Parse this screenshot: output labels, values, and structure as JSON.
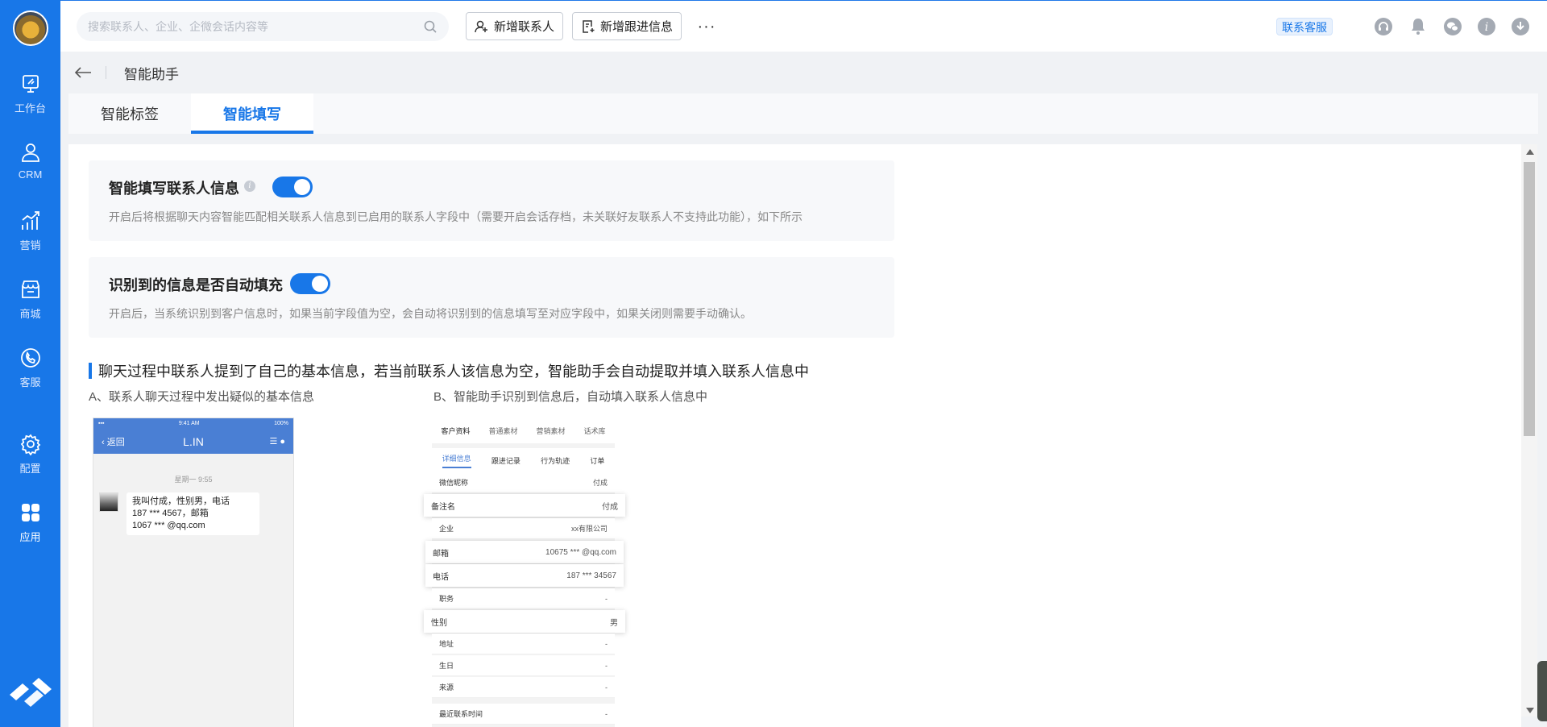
{
  "sidebar": {
    "items": [
      {
        "label": "工作台"
      },
      {
        "label": "CRM"
      },
      {
        "label": "营销"
      },
      {
        "label": "商城"
      },
      {
        "label": "客服"
      },
      {
        "label": "配置"
      },
      {
        "label": "应用"
      }
    ]
  },
  "header": {
    "search_placeholder": "搜索联系人、企业、企微会话内容等",
    "add_contact": "新增联系人",
    "add_followup": "新增跟进信息",
    "more": "···",
    "customer_service": "联系客服"
  },
  "breadcrumb": {
    "title": "智能助手"
  },
  "tabs": [
    {
      "label": "智能标签",
      "active": false
    },
    {
      "label": "智能填写",
      "active": true
    }
  ],
  "settings": {
    "fill_contact": {
      "title": "智能填写联系人信息",
      "enabled": true,
      "desc": "开启后将根据聊天内容智能匹配相关联系人信息到已启用的联系人字段中（需要开启会话存档，未关联好友联系人不支持此功能），如下所示"
    },
    "auto_fill": {
      "title": "识别到的信息是否自动填充",
      "enabled": true,
      "desc": "开启后，当系统识别到客户信息时，如果当前字段值为空，会自动将识别到的信息填写至对应字段中，如果关闭则需要手动确认。"
    }
  },
  "example": {
    "heading": "聊天过程中联系人提到了自己的基本信息，若当前联系人该信息为空，智能助手会自动提取并填入联系人信息中",
    "label_a": "A、联系人聊天过程中发出疑似的基本信息",
    "label_b": "B、智能助手识别到信息后，自动填入联系人信息中",
    "phone": {
      "status_time": "9:41 AM",
      "status_battery": "100%",
      "back": "返回",
      "name": "L.IN",
      "time": "星期一 9:55",
      "message": "我叫付成，性别男，电话\n187 *** 4567，邮箱\n1067 *** @qq.com"
    },
    "form": {
      "tabs": [
        "客户资料",
        "普通素材",
        "营销素材",
        "话术库"
      ],
      "subtabs": [
        "详细信息",
        "跟进记录",
        "行为轨迹",
        "订单"
      ],
      "rows": [
        {
          "label": "微信昵称",
          "value": "付成",
          "pop": false
        },
        {
          "label": "备注名",
          "value": "付成",
          "pop": true
        },
        {
          "label": "企业",
          "value": "xx有限公司",
          "pop": false
        },
        {
          "label": "邮箱",
          "value": "10675 *** @qq.com",
          "pop": true
        },
        {
          "label": "电话",
          "value": "187 *** 34567",
          "pop": true
        },
        {
          "label": "职务",
          "value": "-",
          "pop": false
        },
        {
          "label": "性别",
          "value": "男",
          "pop": true
        },
        {
          "label": "地址",
          "value": "-",
          "pop": false
        },
        {
          "label": "生日",
          "value": "-",
          "pop": false
        },
        {
          "label": "来源",
          "value": "-",
          "pop": false
        },
        {
          "label": "最近联系时间",
          "value": "-",
          "pop": false
        }
      ]
    }
  },
  "colors": {
    "primary": "#1877e8",
    "sidebar": "#1877e8"
  }
}
